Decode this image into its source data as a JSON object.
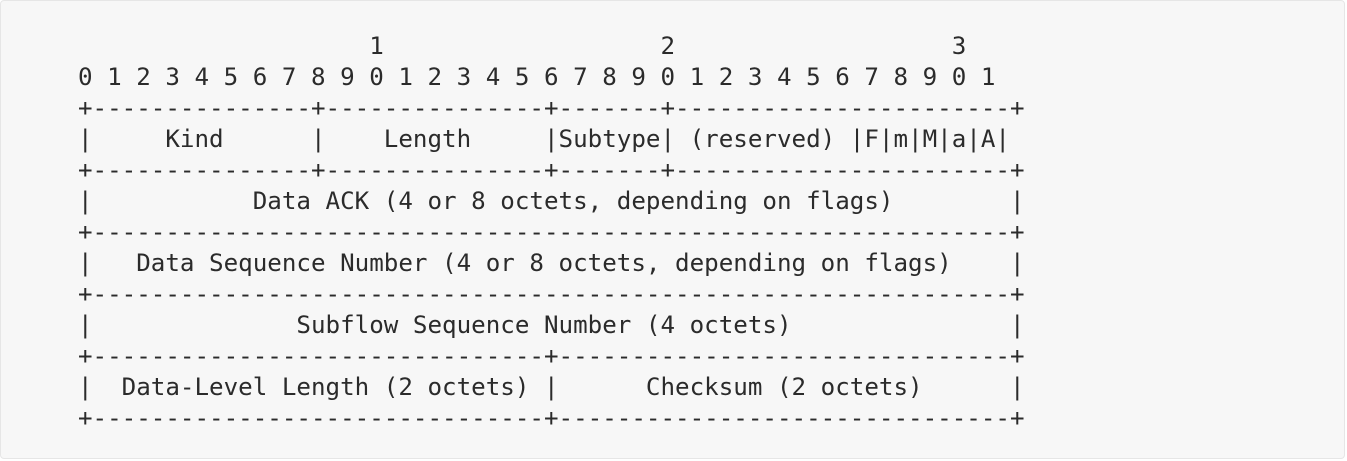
{
  "diagram": {
    "lines": [
      "                    1                   2                   3",
      "0 1 2 3 4 5 6 7 8 9 0 1 2 3 4 5 6 7 8 9 0 1 2 3 4 5 6 7 8 9 0 1",
      "+---------------+---------------+-------+-----------------------+",
      "|     Kind      |    Length     |Subtype| (reserved) |F|m|M|a|A|",
      "+---------------+---------------+-------+-----------------------+",
      "|           Data ACK (4 or 8 octets, depending on flags)        |",
      "+---------------------------------------------------------------+",
      "|   Data Sequence Number (4 or 8 octets, depending on flags)    |",
      "+---------------------------------------------------------------+",
      "|              Subflow Sequence Number (4 octets)               |",
      "+-------------------------------+-------------------------------+",
      "|  Data-Level Length (2 octets) |      Checksum (2 octets)      |",
      "+-------------------------------+-------------------------------+"
    ]
  }
}
